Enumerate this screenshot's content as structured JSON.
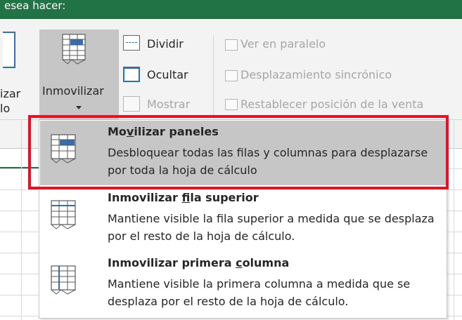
{
  "tellme": {
    "text": "esea hacer:"
  },
  "ribbon": {
    "left_button": {
      "label_line1": "izar",
      "label_line2": "lo"
    },
    "freeze_button": {
      "label": "Inmovilizar",
      "caret": "chevron-down-icon"
    },
    "window_group": [
      {
        "label": "Dividir",
        "icon": "split-icon",
        "enabled": true
      },
      {
        "label": "Ocultar",
        "icon": "hide-window-icon",
        "enabled": true
      },
      {
        "label": "Mostrar",
        "icon": "show-window-icon",
        "enabled": false
      }
    ],
    "compare_group": [
      {
        "label": "Ver en paralelo",
        "icon": "side-by-side-icon",
        "enabled": false
      },
      {
        "label": "Desplazamiento sincrónico",
        "icon": "sync-scroll-icon",
        "enabled": false
      },
      {
        "label": "Restablecer posición de la venta",
        "icon": "reset-window-icon",
        "enabled": false
      }
    ]
  },
  "menu": {
    "items": [
      {
        "title_pre": "Mo",
        "title_u": "v",
        "title_post": "ilizar paneles",
        "description": "Desbloquear todas las filas y columnas para desplazarse por toda la hoja de cálculo",
        "highlighted": true
      },
      {
        "title_pre": "Inmovilizar ",
        "title_u": "f",
        "title_post": "ila superior",
        "description": "Mantiene visible la fila superior a medida que se desplaza por el resto de la hoja de cálculo.",
        "highlighted": false
      },
      {
        "title_pre": "Inmovilizar primera ",
        "title_u": "c",
        "title_post": "olumna",
        "description": "Mantiene visible la primera columna a medida que se desplaza por el resto de la hoja de cálculo.",
        "highlighted": false
      }
    ]
  },
  "colors": {
    "excel_green": "#217346",
    "highlight_gray": "#c6c6c6",
    "annotation_red": "#e81123"
  }
}
